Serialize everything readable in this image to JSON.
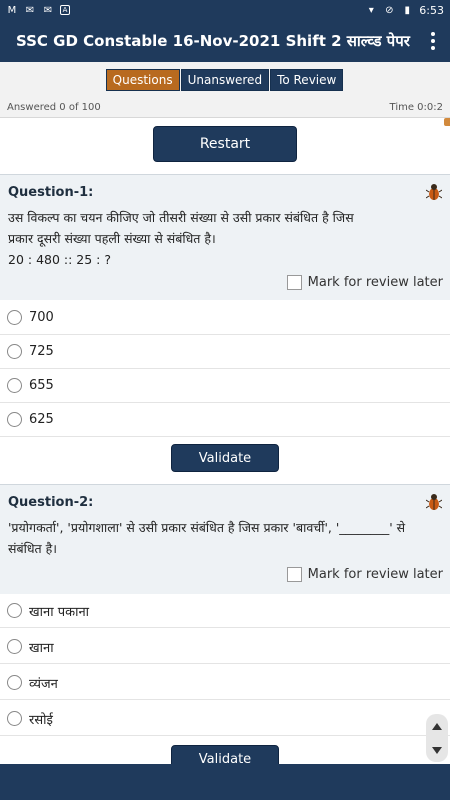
{
  "status_bar": {
    "icons": [
      "m-icon",
      "gmail-icon",
      "gmail-icon",
      "a-icon"
    ],
    "time": "6:53"
  },
  "app_bar": {
    "title": "SSC GD Constable 16-Nov-2021 Shift 2 साल्व्ड पेपर"
  },
  "tabs": [
    {
      "label": "Questions",
      "active": true
    },
    {
      "label": "Unanswered",
      "active": false
    },
    {
      "label": "To Review",
      "active": false
    }
  ],
  "info": {
    "answered": "Answered 0 of 100",
    "time": "Time 0:0:2"
  },
  "restart_label": "Restart",
  "questions": [
    {
      "title": "Question-1:",
      "text_line1": "उस विकल्प का चयन कीजिए जो तीसरी संख्या से उसी प्रकार संबंधित है जिस",
      "text_line2": "प्रकार दूसरी संख्या पहली संख्या से संबंधित है।",
      "text_line3": "20 : 480 :: 25 : ?",
      "mark_review": "Mark for review later",
      "options": [
        "700",
        "725",
        "655",
        "625"
      ],
      "validate": "Validate"
    },
    {
      "title": "Question-2:",
      "text_line1": "'प्रयोगकर्ता', 'प्रयोगशाला' से उसी प्रकार संबंधित है जिस प्रकार 'बावर्ची', '________' से",
      "text_line2": "संबंधित है।",
      "mark_review": "Mark for review later",
      "options": [
        "खाना पकाना",
        "खाना",
        "व्यंजन",
        "रसोई"
      ],
      "validate": "Validate"
    }
  ],
  "colors": {
    "primary": "#1f3a5c",
    "active_tab": "#b86a1f",
    "question_bg": "#eef2f5"
  }
}
